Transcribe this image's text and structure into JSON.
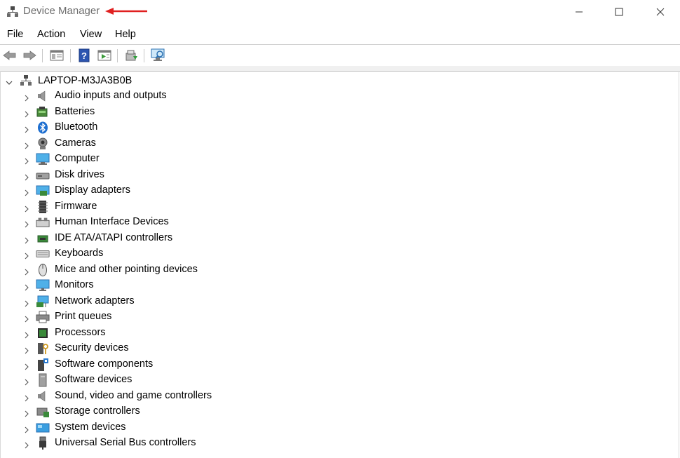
{
  "window": {
    "title": "Device Manager"
  },
  "menu": [
    "File",
    "Action",
    "View",
    "Help"
  ],
  "toolbar": {
    "icons": [
      "back-icon",
      "forward-icon",
      "properties-pane-icon",
      "help-icon",
      "show-hidden-icon",
      "update-driver-icon",
      "scan-hardware-icon"
    ]
  },
  "tree": {
    "root": "LAPTOP-M3JA3B0B",
    "categories": [
      {
        "label": "Audio inputs and outputs",
        "icon": "speaker-icon"
      },
      {
        "label": "Batteries",
        "icon": "battery-icon"
      },
      {
        "label": "Bluetooth",
        "icon": "bluetooth-icon"
      },
      {
        "label": "Cameras",
        "icon": "camera-icon"
      },
      {
        "label": "Computer",
        "icon": "computer-icon"
      },
      {
        "label": "Disk drives",
        "icon": "disk-drive-icon"
      },
      {
        "label": "Display adapters",
        "icon": "display-adapter-icon"
      },
      {
        "label": "Firmware",
        "icon": "firmware-icon"
      },
      {
        "label": "Human Interface Devices",
        "icon": "hid-icon"
      },
      {
        "label": "IDE ATA/ATAPI controllers",
        "icon": "ide-controller-icon"
      },
      {
        "label": "Keyboards",
        "icon": "keyboard-icon"
      },
      {
        "label": "Mice and other pointing devices",
        "icon": "mouse-icon"
      },
      {
        "label": "Monitors",
        "icon": "monitor-icon"
      },
      {
        "label": "Network adapters",
        "icon": "network-adapter-icon"
      },
      {
        "label": "Print queues",
        "icon": "printer-icon"
      },
      {
        "label": "Processors",
        "icon": "processor-icon"
      },
      {
        "label": "Security devices",
        "icon": "security-device-icon"
      },
      {
        "label": "Software components",
        "icon": "software-component-icon"
      },
      {
        "label": "Software devices",
        "icon": "software-device-icon"
      },
      {
        "label": "Sound, video and game controllers",
        "icon": "sound-controller-icon"
      },
      {
        "label": "Storage controllers",
        "icon": "storage-controller-icon"
      },
      {
        "label": "System devices",
        "icon": "system-device-icon"
      },
      {
        "label": "Universal Serial Bus controllers",
        "icon": "usb-icon"
      }
    ]
  },
  "colors": {
    "annotation_arrow": "#e02020",
    "title_text": "#6d6d6d"
  }
}
